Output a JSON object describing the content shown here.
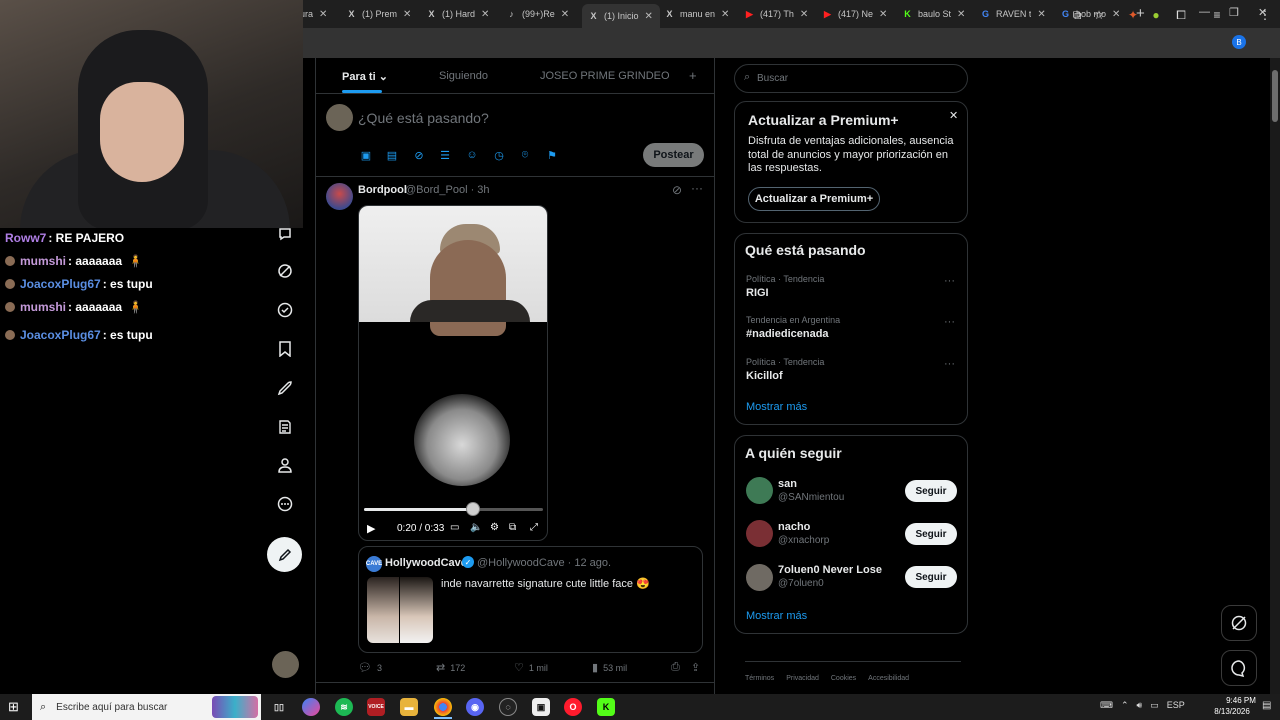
{
  "browser": {
    "tabs": [
      {
        "label": "ura",
        "icon": "generic-tab-icon",
        "icon_glyph": "",
        "left": 0
      },
      {
        "label": "(1) Prem",
        "icon": "x-logo-icon",
        "icon_glyph": "X"
      },
      {
        "label": "(1) Hard",
        "icon": "x-logo-icon",
        "icon_glyph": "X"
      },
      {
        "label": "(99+)Re",
        "icon": "tiktok-icon",
        "icon_glyph": "♪"
      },
      {
        "label": "(1) Inicio",
        "icon": "x-logo-icon",
        "icon_glyph": "X"
      },
      {
        "label": "manu en",
        "icon": "x-logo-icon",
        "icon_glyph": "X"
      },
      {
        "label": "(417) Th",
        "icon": "youtube-icon",
        "icon_glyph": "▶"
      },
      {
        "label": "(417) Ne",
        "icon": "youtube-icon",
        "icon_glyph": "▶"
      },
      {
        "label": "baulo St",
        "icon": "kick-icon",
        "icon_glyph": "K"
      },
      {
        "label": "RAVEN t",
        "icon": "google-icon",
        "icon_glyph": "G"
      },
      {
        "label": "bob mo",
        "icon": "google-icon",
        "icon_glyph": "G"
      }
    ],
    "new_tab": "+",
    "window_controls": [
      "—",
      "❐",
      "✕"
    ],
    "profile_initial": "B"
  },
  "stream_chat": [
    {
      "user": "Roww7",
      "message": ": RE PAJERO",
      "color": "#b07fe6",
      "badge": false
    },
    {
      "user": "mumshi",
      "message": ": aaaaaaa",
      "color": "#c49ad9",
      "badge": true
    },
    {
      "user": "JoacoxPlug67",
      "message": ": es tupu",
      "color": "#5b8fe3",
      "badge": true
    },
    {
      "user": "mumshi",
      "message": ": aaaaaaa",
      "color": "#c49ad9",
      "badge": true
    },
    {
      "user": "JoacoxPlug67",
      "message": ": es tupu",
      "color": "#5b8fe3",
      "badge": true
    }
  ],
  "feed": {
    "tabs": [
      "Para ti",
      "Siguiendo",
      "JOSEO PRIME GRINDEO"
    ],
    "add_tab": "+",
    "composer_placeholder": "¿Qué está pasando?",
    "post_label": "Postear"
  },
  "tweet": {
    "name": "Bordpool",
    "handle_time": "@Bord_Pool · 3h",
    "video_time": "0:20 / 0:33",
    "video_progress": 0.62,
    "quote": {
      "avatar_text": "CAVE",
      "name": "HollywoodCave",
      "handle_time": "@HollywoodCave · 12 ago.",
      "text": "inde navarrette signature cute little face 😍"
    },
    "actions": {
      "replies": "3",
      "reposts": "172",
      "likes": "1 mil",
      "views": "53 mil"
    }
  },
  "sidebar": {
    "search_placeholder": "Buscar",
    "premium": {
      "title": "Actualizar a Premium+",
      "description": "Disfruta de ventajas adicionales, ausencia total de anuncios y mayor priorización en las respuestas.",
      "button": "Actualizar a Premium+"
    },
    "trends": {
      "title": "Qué está pasando",
      "items": [
        {
          "category": "Política · Tendencia",
          "name": "RIGI"
        },
        {
          "category": "Tendencia en Argentina",
          "name": "#nadiedicenada"
        },
        {
          "category": "Política · Tendencia",
          "name": "Kicillof"
        }
      ],
      "show_more": "Mostrar más"
    },
    "follow": {
      "title": "A quién seguir",
      "users": [
        {
          "name": "san",
          "handle": "@SANmientou",
          "button": "Seguir"
        },
        {
          "name": "nacho",
          "handle": "@xnachorp",
          "button": "Seguir"
        },
        {
          "name": "7oluen0 Never Lose",
          "handle": "@7oluen0",
          "button": "Seguir"
        }
      ],
      "show_more": "Mostrar más"
    },
    "footer": [
      "Términos",
      "Privacidad",
      "Cookies",
      "Accesibilidad"
    ]
  },
  "taskbar": {
    "search_placeholder": "Escribe aquí para buscar",
    "language": "ESP",
    "time": "9:46 PM",
    "date": "8/13/2026"
  }
}
